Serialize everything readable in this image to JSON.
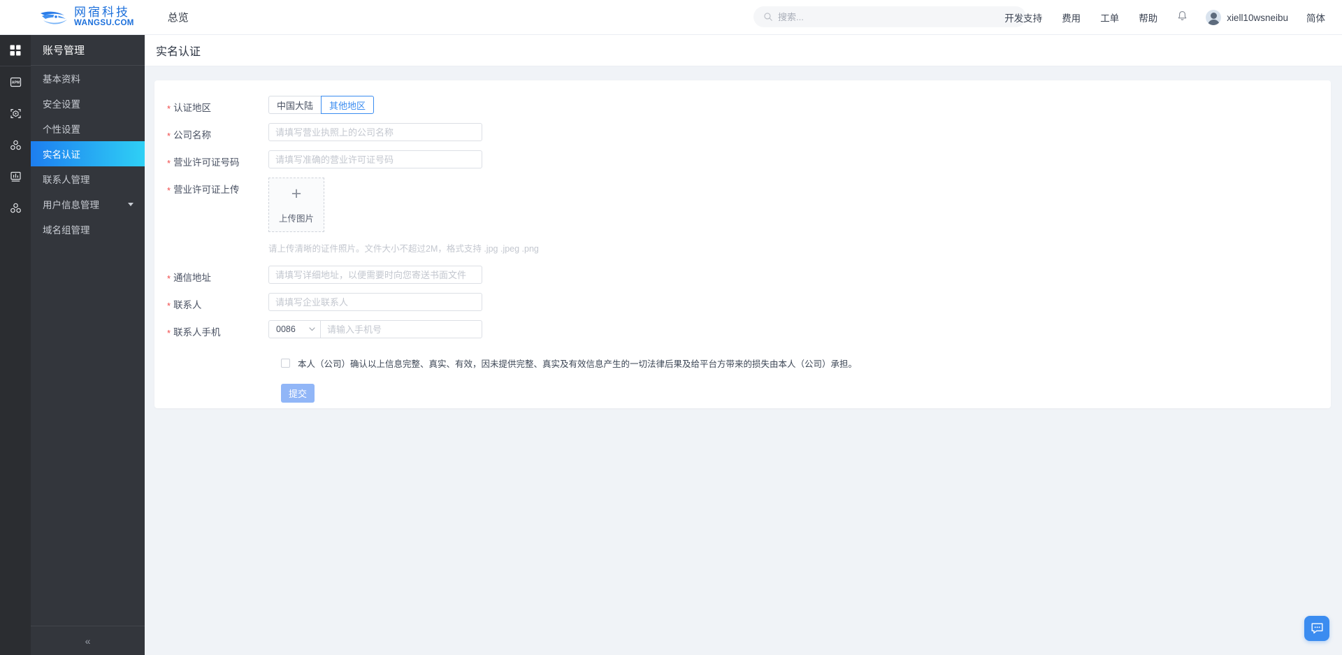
{
  "header": {
    "brand_cn": "网宿科技",
    "brand_en": "WANGSU.COM",
    "overview": "总览",
    "search_placeholder": "搜索...",
    "links": [
      "开发支持",
      "费用",
      "工单",
      "帮助"
    ],
    "user_name": "xiell10wsneibu",
    "language": "简体"
  },
  "sidebar": {
    "title": "账号管理",
    "items": [
      {
        "label": "基本资料",
        "active": false,
        "has_caret": false
      },
      {
        "label": "安全设置",
        "active": false,
        "has_caret": false
      },
      {
        "label": "个性设置",
        "active": false,
        "has_caret": false
      },
      {
        "label": "实名认证",
        "active": true,
        "has_caret": false
      },
      {
        "label": "联系人管理",
        "active": false,
        "has_caret": false
      },
      {
        "label": "用户信息管理",
        "active": false,
        "has_caret": true
      },
      {
        "label": "域名组管理",
        "active": false,
        "has_caret": false
      }
    ],
    "collapse_glyph": "«"
  },
  "page": {
    "title": "实名认证"
  },
  "form": {
    "region": {
      "label": "认证地区",
      "options": [
        "中国大陆",
        "其他地区"
      ],
      "selected": "其他地区"
    },
    "company_name": {
      "label": "公司名称",
      "placeholder": "请填写营业执照上的公司名称",
      "value": ""
    },
    "license_no": {
      "label": "营业许可证号码",
      "placeholder": "请填写准确的营业许可证号码",
      "value": ""
    },
    "license_upload": {
      "label": "营业许可证上传",
      "plus": "+",
      "button_text": "上传图片",
      "hint": "请上传清晰的证件照片。文件大小不超过2M，格式支持 .jpg .jpeg .png"
    },
    "address": {
      "label": "通信地址",
      "placeholder": "请填写详细地址，以便需要时向您寄送书面文件",
      "value": ""
    },
    "contact": {
      "label": "联系人",
      "placeholder": "请填写企业联系人",
      "value": ""
    },
    "phone": {
      "label": "联系人手机",
      "country_code": "0086",
      "placeholder": "请输入手机号",
      "value": ""
    },
    "agreement": {
      "checked": false,
      "text": "本人（公司）确认以上信息完整、真实、有效，因未提供完整、真实及有效信息产生的一切法律后果及给平台方带来的损失由本人（公司）承担。"
    },
    "submit_label": "提交"
  },
  "colors": {
    "accent": "#3b8cf0",
    "active_menu_start": "#1d7ef0",
    "active_menu_end": "#2fd0f5",
    "required_star": "#f04b4b",
    "submit_bg": "#91b6f7",
    "rail_bg": "#2b2d31",
    "sidebar_bg": "#33363c"
  }
}
